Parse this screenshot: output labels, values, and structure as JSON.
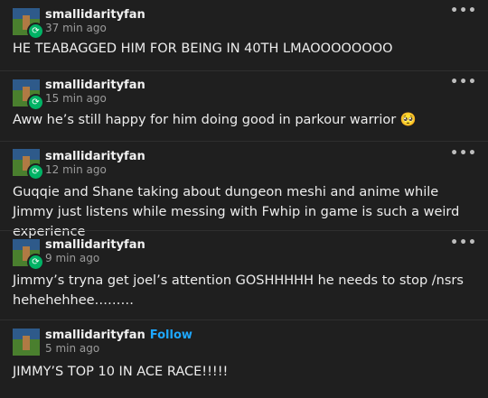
{
  "posts": [
    {
      "username": "smallidarityfan",
      "time": "37 min ago",
      "text": "HE TEABAGGED HIM FOR BEING IN 40TH LMAOOOOOOOO",
      "follow": ""
    },
    {
      "username": "smallidarityfan",
      "time": "15 min ago",
      "text": "Aww he’s still happy for him doing good in parkour warrior 🥺",
      "follow": ""
    },
    {
      "username": "smallidarityfan",
      "time": "12 min ago",
      "text": "Guqqie and Shane taking about dungeon meshi and anime while Jimmy just listens while messing with Fwhip in game is such a weird experience",
      "follow": ""
    },
    {
      "username": "smallidarityfan",
      "time": "9 min ago",
      "text": "Jimmy’s tryna get joel’s attention GOSHHHHH he needs to stop /nsrs hehehehhee………",
      "follow": ""
    },
    {
      "username": "smallidarityfan",
      "time": "5 min ago",
      "text": "JIMMY’S TOP 10 IN ACE RACE!!!!!",
      "follow": "Follow"
    }
  ],
  "icons": {
    "more": "more-options-icon",
    "reblog_badge": "reblog-icon"
  },
  "colors": {
    "background": "#1f1f1f",
    "follow": "#1ea7ff",
    "badge": "#00b365"
  }
}
